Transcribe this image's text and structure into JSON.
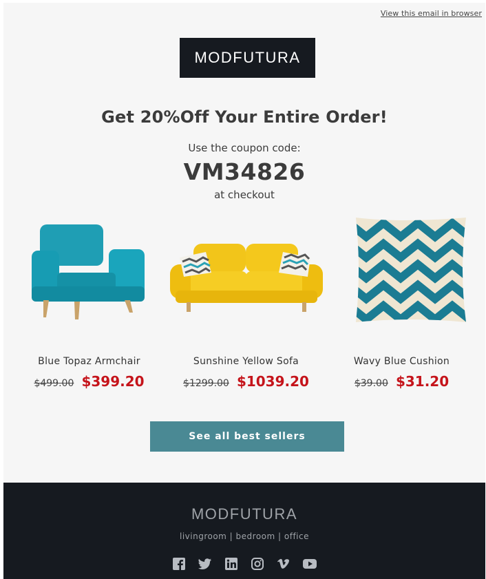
{
  "header": {
    "view_in_browser": "View this email in browser",
    "logo": "MODFUTURA"
  },
  "promo": {
    "headline": "Get 20%Off Your Entire Order!",
    "coupon_label": "Use the coupon code:",
    "coupon_code": "VM34826",
    "coupon_suffix": "at checkout"
  },
  "products": [
    {
      "name": "Blue Topaz Armchair",
      "old_price": "$499.00",
      "new_price": "$399.20",
      "icon": "armchair-image"
    },
    {
      "name": "Sunshine Yellow Sofa",
      "old_price": "$1299.00",
      "new_price": "$1039.20",
      "icon": "sofa-image"
    },
    {
      "name": "Wavy Blue Cushion",
      "old_price": "$39.00",
      "new_price": "$31.20",
      "icon": "cushion-image"
    }
  ],
  "cta": {
    "label": "See all best sellers"
  },
  "footer": {
    "brand": "MODFUTURA",
    "tagline": "livingroom | bedroom | office",
    "social": [
      "facebook-icon",
      "twitter-icon",
      "linkedin-icon",
      "instagram-icon",
      "vimeo-icon",
      "youtube-icon"
    ]
  },
  "colors": {
    "dark": "#161a20",
    "accent": "#4a8994",
    "sale": "#c5141b",
    "background": "#f6f6f6"
  }
}
